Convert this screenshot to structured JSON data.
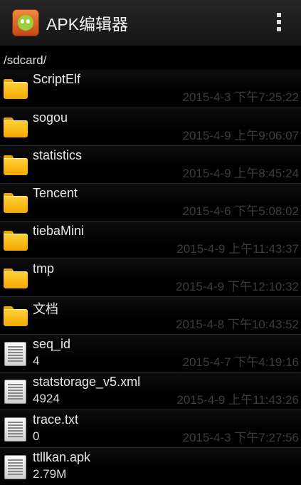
{
  "app": {
    "title": "APK编辑器"
  },
  "path": "/sdcard/",
  "items": [
    {
      "type": "folder",
      "name": "ScriptElf",
      "sub": "",
      "date": "2015-4-3 下午7:25:22"
    },
    {
      "type": "folder",
      "name": "sogou",
      "sub": "",
      "date": "2015-4-9 上午9:06:07"
    },
    {
      "type": "folder",
      "name": "statistics",
      "sub": "",
      "date": "2015-4-9 上午8:45:24"
    },
    {
      "type": "folder",
      "name": "Tencent",
      "sub": "",
      "date": "2015-4-6 下午5:08:02"
    },
    {
      "type": "folder",
      "name": "tiebaMini",
      "sub": "",
      "date": "2015-4-9 上午11:43:37"
    },
    {
      "type": "folder",
      "name": "tmp",
      "sub": "",
      "date": "2015-4-9 下午12:10:32"
    },
    {
      "type": "folder",
      "name": "文档",
      "sub": "",
      "date": "2015-4-8 下午10:43:52"
    },
    {
      "type": "file",
      "name": "seq_id",
      "sub": "4",
      "date": "2015-4-7 下午4:19:16"
    },
    {
      "type": "file",
      "name": "statstorage_v5.xml",
      "sub": "4924",
      "date": "2015-4-9 上午11:43:26"
    },
    {
      "type": "file",
      "name": "trace.txt",
      "sub": "0",
      "date": "2015-4-3 下午7:27:56"
    },
    {
      "type": "file",
      "name": "ttllkan.apk",
      "sub": "2.79M",
      "date": ""
    }
  ]
}
